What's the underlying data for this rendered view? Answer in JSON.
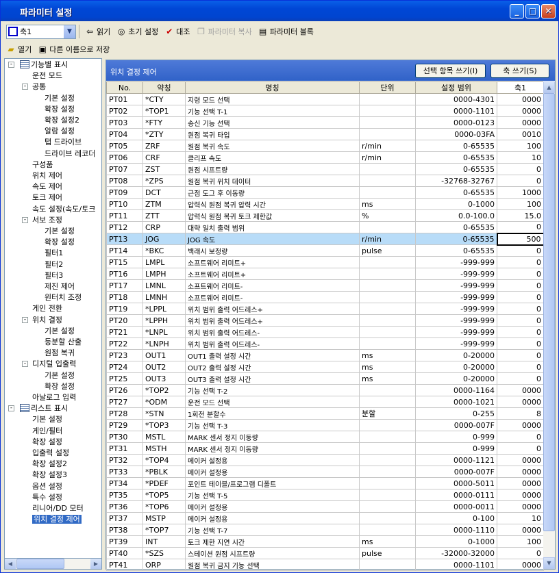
{
  "window": {
    "title": "파라미터 설정",
    "min": "_",
    "max": "□",
    "close": "✕"
  },
  "toolbar": {
    "axis": "축1",
    "read": "읽기",
    "init": "초기 설정",
    "compare": "대조",
    "copy": "파라미터 복사",
    "block": "파라미터 블록",
    "open": "열기",
    "saveas": "다른 이름으로 저장"
  },
  "tree": [
    {
      "l": "기능별 표시",
      "lv": 0,
      "exp": "-",
      "ico": true
    },
    {
      "l": "운전 모드",
      "lv": 1
    },
    {
      "l": "공통",
      "lv": 1,
      "exp": "-"
    },
    {
      "l": "기본 설정",
      "lv": 2
    },
    {
      "l": "확장 설정",
      "lv": 2
    },
    {
      "l": "확장 설정2",
      "lv": 2
    },
    {
      "l": "알람 설정",
      "lv": 2
    },
    {
      "l": "탭 드라이브",
      "lv": 2
    },
    {
      "l": "드라이브 레코더",
      "lv": 2
    },
    {
      "l": "구성품",
      "lv": 1
    },
    {
      "l": "위치 제어",
      "lv": 1
    },
    {
      "l": "속도 제어",
      "lv": 1
    },
    {
      "l": "토크 제어",
      "lv": 1
    },
    {
      "l": "속도 설정(속도/토크",
      "lv": 1
    },
    {
      "l": "서보 조정",
      "lv": 1,
      "exp": "-"
    },
    {
      "l": "기본 설정",
      "lv": 2
    },
    {
      "l": "확장 설정",
      "lv": 2
    },
    {
      "l": "필터1",
      "lv": 2
    },
    {
      "l": "필터2",
      "lv": 2
    },
    {
      "l": "필터3",
      "lv": 2
    },
    {
      "l": "제진 제어",
      "lv": 2
    },
    {
      "l": "원터치 조정",
      "lv": 2
    },
    {
      "l": "게인 전환",
      "lv": 1
    },
    {
      "l": "위치 결정",
      "lv": 1,
      "exp": "-"
    },
    {
      "l": "기본 설정",
      "lv": 2
    },
    {
      "l": "등분할 산출",
      "lv": 2
    },
    {
      "l": "원점 복귀",
      "lv": 2
    },
    {
      "l": "디지털 입출력",
      "lv": 1,
      "exp": "-"
    },
    {
      "l": "기본 설정",
      "lv": 2
    },
    {
      "l": "확장 설정",
      "lv": 2
    },
    {
      "l": "아날로그 입력",
      "lv": 1
    },
    {
      "l": "리스트 표시",
      "lv": 0,
      "exp": "-",
      "ico": true
    },
    {
      "l": "기본 설정",
      "lv": 1
    },
    {
      "l": "게인/필터",
      "lv": 1
    },
    {
      "l": "확장 설정",
      "lv": 1
    },
    {
      "l": "입출력 설정",
      "lv": 1
    },
    {
      "l": "확장 설정2",
      "lv": 1
    },
    {
      "l": "확장 설정3",
      "lv": 1
    },
    {
      "l": "옵션 설정",
      "lv": 1
    },
    {
      "l": "특수 설정",
      "lv": 1
    },
    {
      "l": "리니어/DD 모터",
      "lv": 1
    },
    {
      "l": "위치 결정 제어",
      "lv": 1,
      "sel": true
    }
  ],
  "panel": {
    "title": "위치 결정 제어",
    "write_selected": "선택 항목 쓰기(I)",
    "write_axis": "축 쓰기(S)"
  },
  "columns": [
    "No.",
    "약칭",
    "명칭",
    "단위",
    "설정 범위",
    "축1"
  ],
  "rows": [
    [
      "PT01",
      "*CTY",
      "지령 모드 선택",
      "",
      "0000-4301",
      "0000"
    ],
    [
      "PT02",
      "*TOP1",
      "기능 선택 T-1",
      "",
      "0000-1101",
      "0000"
    ],
    [
      "PT03",
      "*FTY",
      "송신 기능 선택",
      "",
      "0000-0123",
      "0000"
    ],
    [
      "PT04",
      "*ZTY",
      "원점 복귀 타입",
      "",
      "0000-03FA",
      "0010"
    ],
    [
      "PT05",
      "ZRF",
      "원점 복귀 속도",
      "r/min",
      "0-65535",
      "100"
    ],
    [
      "PT06",
      "CRF",
      "클리프 속도",
      "r/min",
      "0-65535",
      "10"
    ],
    [
      "PT07",
      "ZST",
      "원점 시프트량",
      "",
      "0-65535",
      "0"
    ],
    [
      "PT08",
      "*ZPS",
      "원점 복귀 위치 데이터",
      "",
      "-32768-32767",
      "0"
    ],
    [
      "PT09",
      "DCT",
      "근점 도그 후 이동량",
      "",
      "0-65535",
      "1000"
    ],
    [
      "PT10",
      "ZTM",
      "압력식 원점 복귀 압력 시간",
      "ms",
      "0-1000",
      "100"
    ],
    [
      "PT11",
      "ZTT",
      "압력식 원점 복귀 토크 제한값",
      "%",
      "0.0-100.0",
      "15.0"
    ],
    [
      "PT12",
      "CRP",
      "대략 일치 출력 범위",
      "",
      "0-65535",
      "0"
    ],
    [
      "PT13",
      "JOG",
      "JOG 속도",
      "r/min",
      "0-65535",
      "500"
    ],
    [
      "PT14",
      "*BKC",
      "백래시 보정량",
      "pulse",
      "0-65535",
      "0"
    ],
    [
      "PT15",
      "LMPL",
      "소프트웨어 리미트+",
      "",
      "-999-999",
      "0"
    ],
    [
      "PT16",
      "LMPH",
      "소프트웨어 리미트+",
      "",
      "-999-999",
      "0"
    ],
    [
      "PT17",
      "LMNL",
      "소프트웨어 리미트-",
      "",
      "-999-999",
      "0"
    ],
    [
      "PT18",
      "LMNH",
      "소프트웨어 리미트-",
      "",
      "-999-999",
      "0"
    ],
    [
      "PT19",
      "*LPPL",
      "위치 범위 출력 어드레스+",
      "",
      "-999-999",
      "0"
    ],
    [
      "PT20",
      "*LPPH",
      "위치 범위 출력 어드레스+",
      "",
      "-999-999",
      "0"
    ],
    [
      "PT21",
      "*LNPL",
      "위치 범위 출력 어드레스-",
      "",
      "-999-999",
      "0"
    ],
    [
      "PT22",
      "*LNPH",
      "위치 범위 출력 어드레스-",
      "",
      "-999-999",
      "0"
    ],
    [
      "PT23",
      "OUT1",
      "OUT1 출력 설정 시간",
      "ms",
      "0-20000",
      "0"
    ],
    [
      "PT24",
      "OUT2",
      "OUT2 출력 설정 시간",
      "ms",
      "0-20000",
      "0"
    ],
    [
      "PT25",
      "OUT3",
      "OUT3 출력 설정 시간",
      "ms",
      "0-20000",
      "0"
    ],
    [
      "PT26",
      "*TOP2",
      "기능 선택 T-2",
      "",
      "0000-1164",
      "0000"
    ],
    [
      "PT27",
      "*ODM",
      "운전 모드 선택",
      "",
      "0000-1021",
      "0000"
    ],
    [
      "PT28",
      "*STN",
      "1회전 분할수",
      "분할",
      "0-255",
      "8"
    ],
    [
      "PT29",
      "*TOP3",
      "기능 선택 T-3",
      "",
      "0000-007F",
      "0000"
    ],
    [
      "PT30",
      "MSTL",
      "MARK 센서 정지 이동량",
      "",
      "0-999",
      "0"
    ],
    [
      "PT31",
      "MSTH",
      "MARK 센서 정지 이동량",
      "",
      "0-999",
      "0"
    ],
    [
      "PT32",
      "*TOP4",
      "메이커 설정용",
      "",
      "0000-1121",
      "0000"
    ],
    [
      "PT33",
      "*PBLK",
      "메이커 설정용",
      "",
      "0000-007F",
      "0000"
    ],
    [
      "PT34",
      "*PDEF",
      "포인트 테이블/프로그램 디폴트",
      "",
      "0000-5011",
      "0000"
    ],
    [
      "PT35",
      "*TOP5",
      "기능 선택 T-5",
      "",
      "0000-0111",
      "0000"
    ],
    [
      "PT36",
      "*TOP6",
      "메이커 설정용",
      "",
      "0000-0011",
      "0000"
    ],
    [
      "PT37",
      "MSTP",
      "메이커 설정용",
      "",
      "0-100",
      "10"
    ],
    [
      "PT38",
      "*TOP7",
      "기능 선택 T-7",
      "",
      "0000-1110",
      "0000"
    ],
    [
      "PT39",
      "INT",
      "토크 제한 지연 시간",
      "ms",
      "0-1000",
      "100"
    ],
    [
      "PT40",
      "*SZS",
      "스테이션 원점 시프트량",
      "pulse",
      "-32000-32000",
      "0"
    ],
    [
      "PT41",
      "ORP",
      "원점 복귀 금지 기능 선택",
      "",
      "0000-1101",
      "0000"
    ]
  ],
  "highlight_row": "PT13"
}
